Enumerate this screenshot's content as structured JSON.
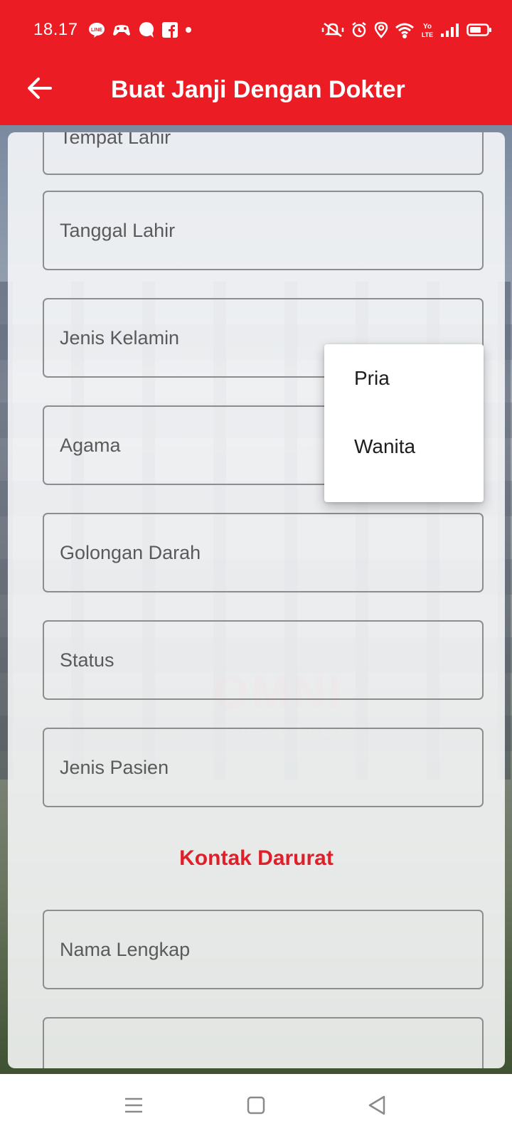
{
  "status_bar": {
    "time": "18.17",
    "notification_icons": [
      "line-icon",
      "game-controller-icon",
      "chat-bubble-icon",
      "facebook-icon",
      "dot-icon"
    ],
    "system_icons": [
      "mute-vibrate-icon",
      "alarm-icon",
      "location-icon",
      "wifi-icon",
      "volte-icon",
      "signal-icon",
      "battery-icon"
    ]
  },
  "app_bar": {
    "title": "Buat Janji Dengan Dokter",
    "back_icon": "arrow-left-icon"
  },
  "form": {
    "fields": [
      {
        "label": "Tempat Lahir"
      },
      {
        "label": "Tanggal Lahir"
      },
      {
        "label": "Jenis Kelamin"
      },
      {
        "label": "Agama"
      },
      {
        "label": "Golongan Darah"
      },
      {
        "label": "Status"
      },
      {
        "label": "Jenis Pasien"
      }
    ],
    "emergency_section_title": "Kontak Darurat",
    "emergency_fields": [
      {
        "label": "Nama Lengkap"
      },
      {
        "label": ""
      }
    ]
  },
  "dropdown": {
    "options": [
      "Pria",
      "Wanita"
    ]
  },
  "nav_bar": {
    "icons": [
      "menu-icon",
      "home-square-icon",
      "back-triangle-icon"
    ]
  },
  "colors": {
    "accent": "#ec1c24",
    "section_title": "#e01f29"
  }
}
